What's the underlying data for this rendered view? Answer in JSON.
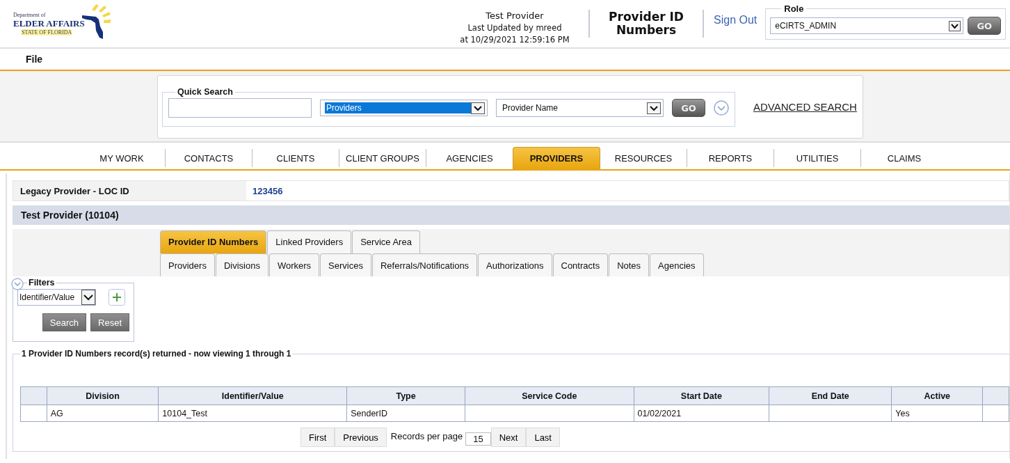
{
  "header": {
    "logo": {
      "department": "Department of",
      "name": "ELDER AFFAIRS",
      "state": "STATE OF FLORIDA"
    },
    "record_name": "Test Provider",
    "last_updated": "Last Updated by mreed",
    "timestamp": "at 10/29/2021 12:59:16 PM",
    "page_title": "Provider ID Numbers",
    "sign_out": "Sign Out",
    "role": {
      "label": "Role",
      "value": "eCIRTS_ADMIN",
      "go": "GO"
    }
  },
  "menu": [
    {
      "label": "File"
    }
  ],
  "quick_search": {
    "legend": "Quick Search",
    "category": {
      "value": "Providers",
      "highlighted": true
    },
    "field": {
      "value": "Provider Name",
      "highlighted": false
    },
    "go": "GO",
    "advanced": "ADVANCED SEARCH"
  },
  "nav_tabs": [
    {
      "label": "MY WORK",
      "selected": false
    },
    {
      "label": "CONTACTS",
      "selected": false
    },
    {
      "label": "CLIENTS",
      "selected": false
    },
    {
      "label": "CLIENT GROUPS",
      "selected": false
    },
    {
      "label": "AGENCIES",
      "selected": false
    },
    {
      "label": "PROVIDERS",
      "selected": true
    },
    {
      "label": "RESOURCES",
      "selected": false
    },
    {
      "label": "REPORTS",
      "selected": false
    },
    {
      "label": "UTILITIES",
      "selected": false
    },
    {
      "label": "CLAIMS",
      "selected": false
    }
  ],
  "legacy": {
    "label": "Legacy Provider - LOC ID",
    "value": "123456"
  },
  "provider_header": "Test Provider (10104)",
  "subtabs": [
    [
      {
        "label": "Provider ID Numbers",
        "selected": true
      },
      {
        "label": "Linked Providers",
        "selected": false
      },
      {
        "label": "Service Area",
        "selected": false
      }
    ],
    [
      {
        "label": "Providers",
        "selected": false
      },
      {
        "label": "Divisions",
        "selected": false
      },
      {
        "label": "Workers",
        "selected": false
      },
      {
        "label": "Services",
        "selected": false
      },
      {
        "label": "Referrals/Notifications",
        "selected": false
      },
      {
        "label": "Authorizations",
        "selected": false
      },
      {
        "label": "Contracts",
        "selected": false
      },
      {
        "label": "Notes",
        "selected": false
      },
      {
        "label": "Agencies",
        "selected": false
      }
    ]
  ],
  "filters": {
    "legend": "Filters",
    "field": "Identifier/Value",
    "search": "Search",
    "reset": "Reset"
  },
  "results": {
    "legend": "1 Provider ID Numbers record(s) returned - now viewing 1 through 1",
    "columns": [
      "Division",
      "Identifier/Value",
      "Type",
      "Service Code",
      "Start Date",
      "End Date",
      "Active"
    ],
    "rows": [
      [
        "AG",
        "10104_Test",
        "SenderID",
        "",
        "01/02/2021",
        "",
        "Yes"
      ]
    ]
  },
  "pager": {
    "first": "First",
    "previous": "Previous",
    "per_page_label": "Records per page",
    "per_page": "15",
    "next": "Next",
    "last": "Last"
  }
}
